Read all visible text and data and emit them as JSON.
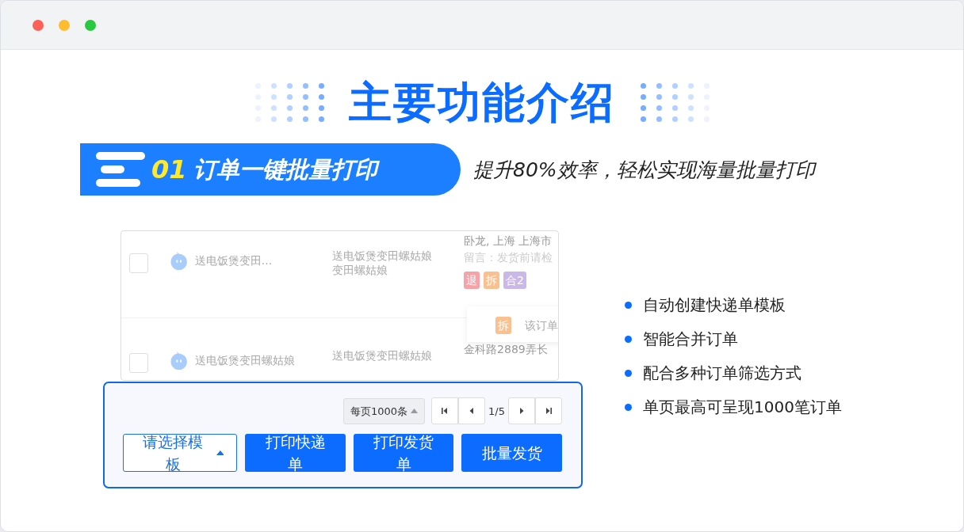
{
  "window": {
    "controls": [
      {
        "color": "#fe5f57"
      },
      {
        "color": "#febc2e"
      },
      {
        "color": "#28c840"
      }
    ]
  },
  "title": "主要功能介绍",
  "feature": {
    "number": "01",
    "name": "订单一键批量打印",
    "tagline": "提升80%效率，轻松实现海量批量打印"
  },
  "orders": [
    {
      "checked": false,
      "name": "送电饭煲变田...",
      "product_lines": [
        "送电饭煲变田螺姑娘",
        "变田螺姑娘"
      ],
      "address": "卧龙, 上海 上海市",
      "note": "留言：发货前请检",
      "tags": [
        {
          "label": "退",
          "color": "#f5a3a8"
        },
        {
          "label": "拆",
          "color": "#fbc08f"
        },
        {
          "label": "合2",
          "color": "#c9b8e8"
        }
      ]
    },
    {
      "checked": false,
      "name": "送电饭煲变田螺姑娘",
      "product_lines": [
        "送电饭煲变田螺姑娘"
      ],
      "address": "金科路2889弄长"
    }
  ],
  "popover": {
    "tag": {
      "label": "拆",
      "color": "#fbc08f"
    },
    "text": "该订单"
  },
  "pagination": {
    "page_size": "每页1000条",
    "page": "1/5"
  },
  "actions": [
    {
      "label": "请选择模板",
      "kind": "dropdown"
    },
    {
      "label": "打印快递单",
      "kind": "primary"
    },
    {
      "label": "打印发货单",
      "kind": "primary"
    },
    {
      "label": "批量发货",
      "kind": "primary"
    }
  ],
  "highlights": [
    "自动创建快递单模板",
    "智能合并订单",
    "配合多种订单筛选方式",
    "单页最高可呈现1000笔订单"
  ]
}
